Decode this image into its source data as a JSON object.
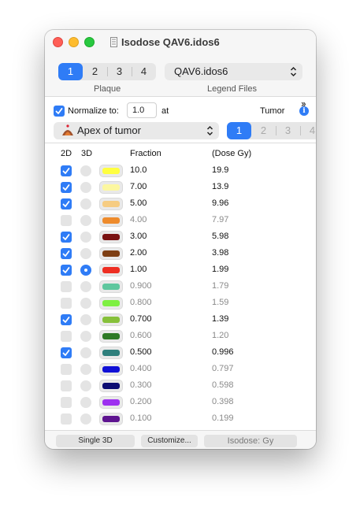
{
  "window": {
    "title": "Isodose QAV6.idos6"
  },
  "top": {
    "plaque_tabs": [
      "1",
      "2",
      "3",
      "4"
    ],
    "plaque_active": 0,
    "plaque_caption": "Plaque",
    "legend_file": "QAV6.idos6",
    "legend_caption": "Legend Files",
    "more_icon": "double-chevron-right-icon"
  },
  "normalize": {
    "checked": true,
    "label": "Normalize to:",
    "value": "1.0",
    "at_label": "at",
    "tumor_label": "Tumor",
    "point": "Apex of tumor",
    "point_icon": "tumor-apex-icon",
    "tumor_tabs": [
      "1",
      "2",
      "3",
      "4"
    ],
    "tumor_active": 0
  },
  "table": {
    "headers": {
      "col_2d": "2D",
      "col_3d": "3D",
      "fraction": "Fraction",
      "dose": "(Dose Gy)"
    },
    "rows": [
      {
        "show2d": true,
        "show3d": false,
        "color": "#ffff40",
        "fraction": "10.0",
        "dose": "19.9"
      },
      {
        "show2d": true,
        "show3d": false,
        "color": "#fcf7a0",
        "fraction": "7.00",
        "dose": "13.9"
      },
      {
        "show2d": true,
        "show3d": false,
        "color": "#f6cc82",
        "fraction": "5.00",
        "dose": "9.96"
      },
      {
        "show2d": false,
        "show3d": false,
        "color": "#ee8b2c",
        "fraction": "4.00",
        "dose": "7.97"
      },
      {
        "show2d": true,
        "show3d": false,
        "color": "#7a1212",
        "fraction": "3.00",
        "dose": "5.98"
      },
      {
        "show2d": true,
        "show3d": false,
        "color": "#7e3f14",
        "fraction": "2.00",
        "dose": "3.98"
      },
      {
        "show2d": true,
        "show3d": true,
        "color": "#ee2e22",
        "fraction": "1.00",
        "dose": "1.99"
      },
      {
        "show2d": false,
        "show3d": false,
        "color": "#5ec79e",
        "fraction": "0.900",
        "dose": "1.79"
      },
      {
        "show2d": false,
        "show3d": false,
        "color": "#7ef042",
        "fraction": "0.800",
        "dose": "1.59"
      },
      {
        "show2d": true,
        "show3d": false,
        "color": "#86c03a",
        "fraction": "0.700",
        "dose": "1.39"
      },
      {
        "show2d": false,
        "show3d": false,
        "color": "#2e7a26",
        "fraction": "0.600",
        "dose": "1.20"
      },
      {
        "show2d": true,
        "show3d": false,
        "color": "#2e7f7c",
        "fraction": "0.500",
        "dose": "0.996"
      },
      {
        "show2d": false,
        "show3d": false,
        "color": "#1010d6",
        "fraction": "0.400",
        "dose": "0.797"
      },
      {
        "show2d": false,
        "show3d": false,
        "color": "#0c0c72",
        "fraction": "0.300",
        "dose": "0.598"
      },
      {
        "show2d": false,
        "show3d": false,
        "color": "#9d30f0",
        "fraction": "0.200",
        "dose": "0.398"
      },
      {
        "show2d": false,
        "show3d": false,
        "color": "#5e1490",
        "fraction": "0.100",
        "dose": "0.199"
      }
    ]
  },
  "bottom": {
    "single3d": "Single 3D",
    "customize": "Customize...",
    "isodose_menu": "Isodose: Gy"
  }
}
